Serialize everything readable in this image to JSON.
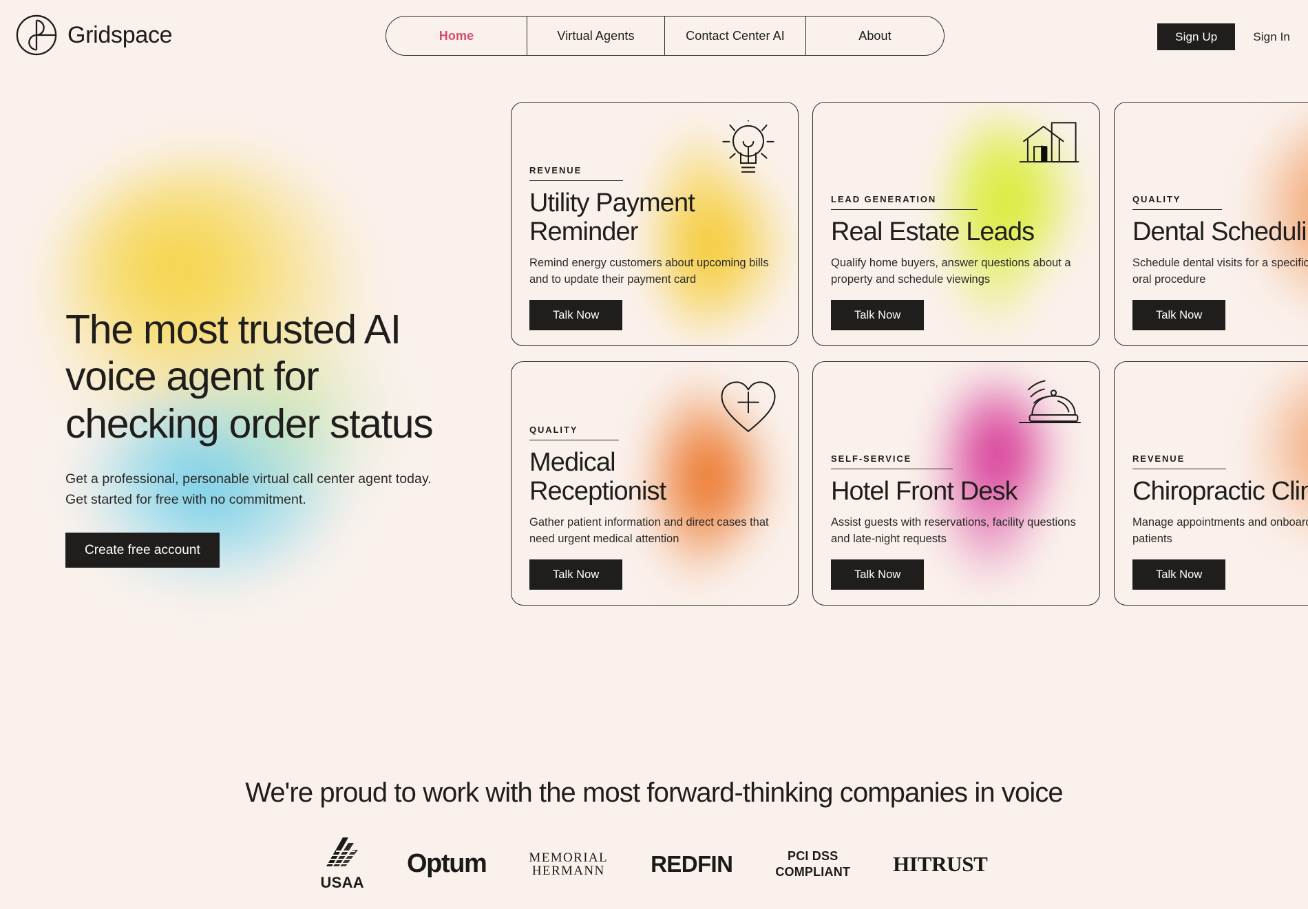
{
  "header": {
    "brand_name": "Gridspace",
    "brand_icon": "gridspace-logo-icon",
    "nav": [
      {
        "label": "Home",
        "active": true
      },
      {
        "label": "Virtual Agents",
        "active": false
      },
      {
        "label": "Contact Center AI",
        "active": false
      },
      {
        "label": "About",
        "active": false
      }
    ],
    "sign_up_label": "Sign Up",
    "sign_in_label": "Sign In",
    "active_color": "#d94a6a"
  },
  "hero": {
    "title": "The most trusted AI voice agent for checking order status",
    "subtitle": "Get a professional, personable virtual call center agent today. Get started for free with no commitment.",
    "cta_label": "Create free account"
  },
  "cards": [
    {
      "eyebrow": "REVENUE",
      "title": "Utility Payment\nReminder",
      "description": "Remind energy customers about upcoming bills\nand to update their payment card",
      "button_label": "Talk Now",
      "icon": "lightbulb-icon",
      "blob_color": "#f6d046"
    },
    {
      "eyebrow": "LEAD GENERATION",
      "title": "Real Estate Leads",
      "description": "Qualify home buyers, answer questions about a\nproperty and schedule viewings",
      "button_label": "Talk Now",
      "icon": "house-icon",
      "blob_color": "#d9ec3a"
    },
    {
      "eyebrow": "QUALITY",
      "title": "Dental Scheduling",
      "description": "Schedule dental visits for a specific\noral procedure",
      "button_label": "Talk Now",
      "icon": "tooth-icon",
      "blob_color": "#f08a4b"
    },
    {
      "eyebrow": "QUALITY",
      "title": "Medical\nReceptionist",
      "description": "Gather patient information and direct cases that\nneed urgent medical attention",
      "button_label": "Talk Now",
      "icon": "heart-plus-icon",
      "blob_color": "#ed7430"
    },
    {
      "eyebrow": "SELF-SERVICE",
      "title": "Hotel Front Desk",
      "description": "Assist guests with reservations, facility questions\nand late-night requests",
      "button_label": "Talk Now",
      "icon": "service-bell-icon",
      "blob_color": "#d6288f"
    },
    {
      "eyebrow": "REVENUE",
      "title": "Chiropractic Clinic",
      "description": "Manage appointments and onboard new\npatients",
      "button_label": "Talk Now",
      "icon": "spine-icon",
      "blob_color": "#f0935c"
    }
  ],
  "social_proof": {
    "title": "We're proud to work with the most forward-thinking companies in voice",
    "logos": [
      {
        "name": "USAA",
        "label": "USAA"
      },
      {
        "name": "Optum",
        "label": "Optum"
      },
      {
        "name": "Memorial Hermann",
        "line1": "MEMORIAL",
        "line2": "HERMANN"
      },
      {
        "name": "Redfin",
        "label": "REDFIN"
      },
      {
        "name": "PCI DSS Compliant",
        "line1": "PCI DSS",
        "line2": "COMPLIANT"
      },
      {
        "name": "HITRUST",
        "label": "HITRUST"
      }
    ]
  },
  "theme": {
    "background": "#faf1ec",
    "ink": "#1f1e1c",
    "accent": "#d94a6a"
  }
}
